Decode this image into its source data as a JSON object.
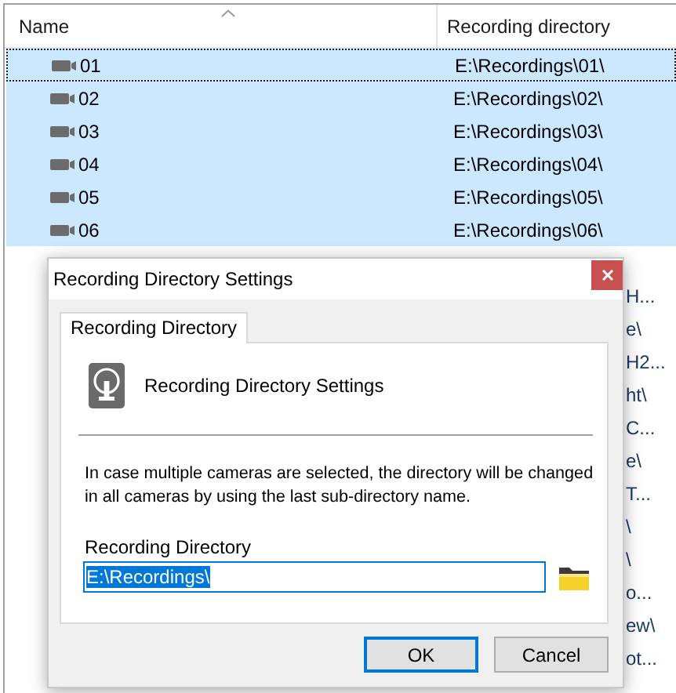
{
  "list": {
    "columns": [
      {
        "label": "Name",
        "sorted": true
      },
      {
        "label": "Recording directory",
        "sorted": false
      }
    ],
    "rows": [
      {
        "kind": "camera",
        "name": "01",
        "directory": "E:\\Recordings\\01\\",
        "selected": true,
        "focused": true
      },
      {
        "kind": "camera",
        "name": "02",
        "directory": "E:\\Recordings\\02\\",
        "selected": true,
        "focused": false
      },
      {
        "kind": "camera",
        "name": "03",
        "directory": "E:\\Recordings\\03\\",
        "selected": true,
        "focused": false
      },
      {
        "kind": "camera",
        "name": "04",
        "directory": "E:\\Recordings\\04\\",
        "selected": true,
        "focused": false
      },
      {
        "kind": "camera",
        "name": "05",
        "directory": "E:\\Recordings\\05\\",
        "selected": true,
        "focused": false
      },
      {
        "kind": "camera",
        "name": "06",
        "directory": "E:\\Recordings\\06\\",
        "selected": true,
        "focused": false
      },
      {
        "kind": "partial",
        "directory": "H...",
        "selected": false,
        "focused": false
      },
      {
        "kind": "partial",
        "directory": "e\\",
        "selected": false,
        "focused": false
      },
      {
        "kind": "partial",
        "directory": "H2...",
        "selected": false,
        "focused": false
      },
      {
        "kind": "partial",
        "directory": "ht\\",
        "selected": false,
        "focused": false
      },
      {
        "kind": "partial",
        "directory": "C...",
        "selected": false,
        "focused": false
      },
      {
        "kind": "partial",
        "directory": "e\\",
        "selected": false,
        "focused": false
      },
      {
        "kind": "partial",
        "directory": "T...",
        "selected": false,
        "focused": false
      },
      {
        "kind": "partial",
        "directory": "\\",
        "selected": false,
        "focused": false
      },
      {
        "kind": "partial",
        "directory": "\\",
        "selected": false,
        "focused": false
      },
      {
        "kind": "partial",
        "directory": "o...",
        "selected": false,
        "focused": false
      },
      {
        "kind": "partial",
        "directory": "ew\\",
        "selected": false,
        "focused": false
      },
      {
        "kind": "partial",
        "directory": "ot...",
        "selected": false,
        "focused": false
      }
    ]
  },
  "dialog": {
    "title": "Recording Directory Settings",
    "tabs": [
      {
        "label": "Recording Directory",
        "selected": true
      }
    ],
    "heading": "Recording Directory Settings",
    "description": "In case multiple cameras are selected, the directory will be changed in all cameras by using the last sub-directory name.",
    "field": {
      "label": "Recording Directory",
      "value": "E:\\Recordings\\",
      "text_selected": true
    },
    "buttons": [
      {
        "label": "OK",
        "default": true
      },
      {
        "label": "Cancel",
        "default": false
      }
    ]
  }
}
